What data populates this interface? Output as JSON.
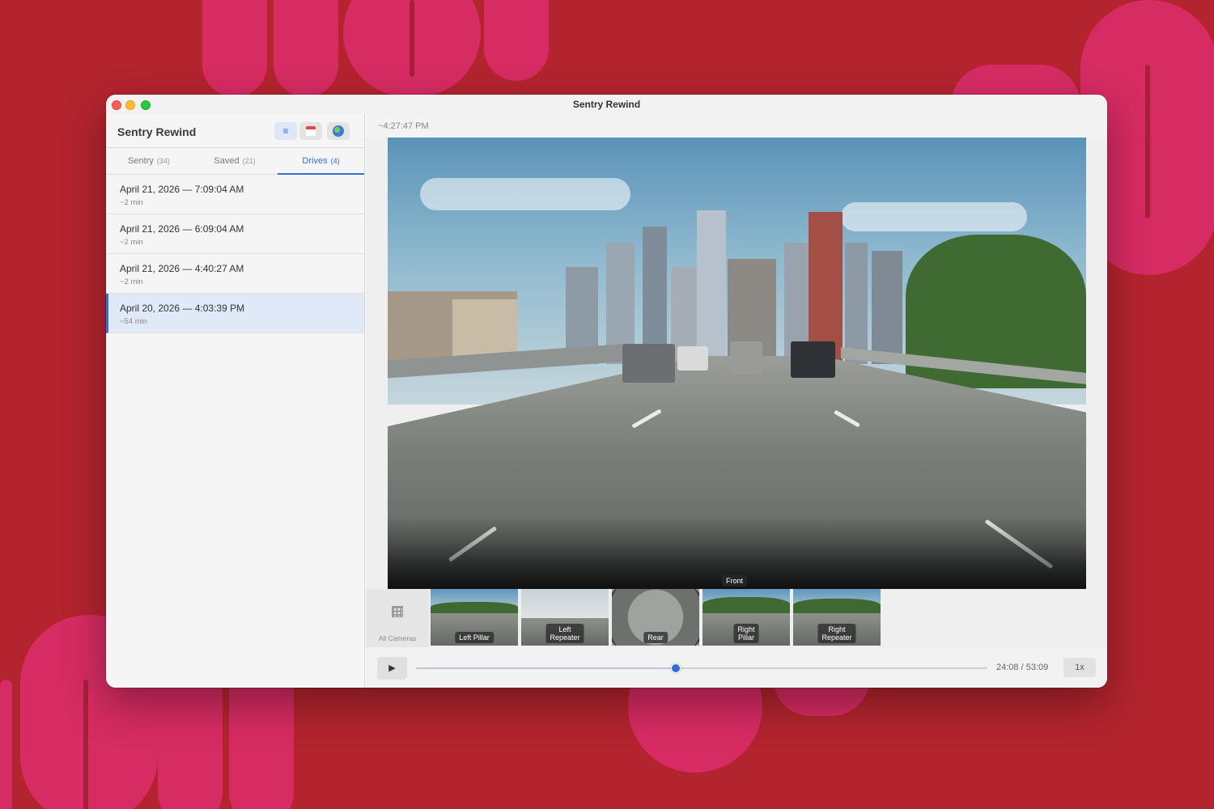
{
  "window": {
    "title": "Sentry Rewind"
  },
  "sidebar": {
    "app_name": "Sentry Rewind",
    "view_buttons": [
      {
        "name": "list-view",
        "icon": "list-icon",
        "glyph": "≡"
      },
      {
        "name": "calendar-view",
        "icon": "calendar-icon",
        "glyph": "17"
      },
      {
        "name": "map-view",
        "icon": "globe-icon",
        "glyph": ""
      }
    ],
    "tabs": [
      {
        "label": "Sentry",
        "count": "(34)"
      },
      {
        "label": "Saved",
        "count": "(21)"
      },
      {
        "label": "Drives",
        "count": "(4)",
        "active": true
      }
    ],
    "drives": [
      {
        "date": "April 21, 2026 — 7:09:04 AM",
        "duration": "~2 min"
      },
      {
        "date": "April 21, 2026 — 6:09:04 AM",
        "duration": "~2 min"
      },
      {
        "date": "April 21, 2026 — 4:40:27 AM",
        "duration": "~2 min"
      },
      {
        "date": "April 20, 2026 — 4:03:39 PM",
        "duration": "~54 min",
        "selected": true
      }
    ]
  },
  "player": {
    "timestamp": "~4:27:47 PM",
    "main_camera": "Front",
    "all_cameras_label": "All Cameras",
    "thumbnails": [
      {
        "label": "Left Pillar"
      },
      {
        "label": "Left\nRepeater"
      },
      {
        "label": "Rear"
      },
      {
        "label": "Right\nPillar"
      },
      {
        "label": "Right\nRepeater"
      }
    ],
    "play_glyph": "▶",
    "time": "24:08 / 53:09",
    "progress_fraction": 0.455,
    "speed": "1x"
  },
  "colors": {
    "accent": "#2f6fd6",
    "background": "#b3242e",
    "decor": "#d62b63"
  }
}
